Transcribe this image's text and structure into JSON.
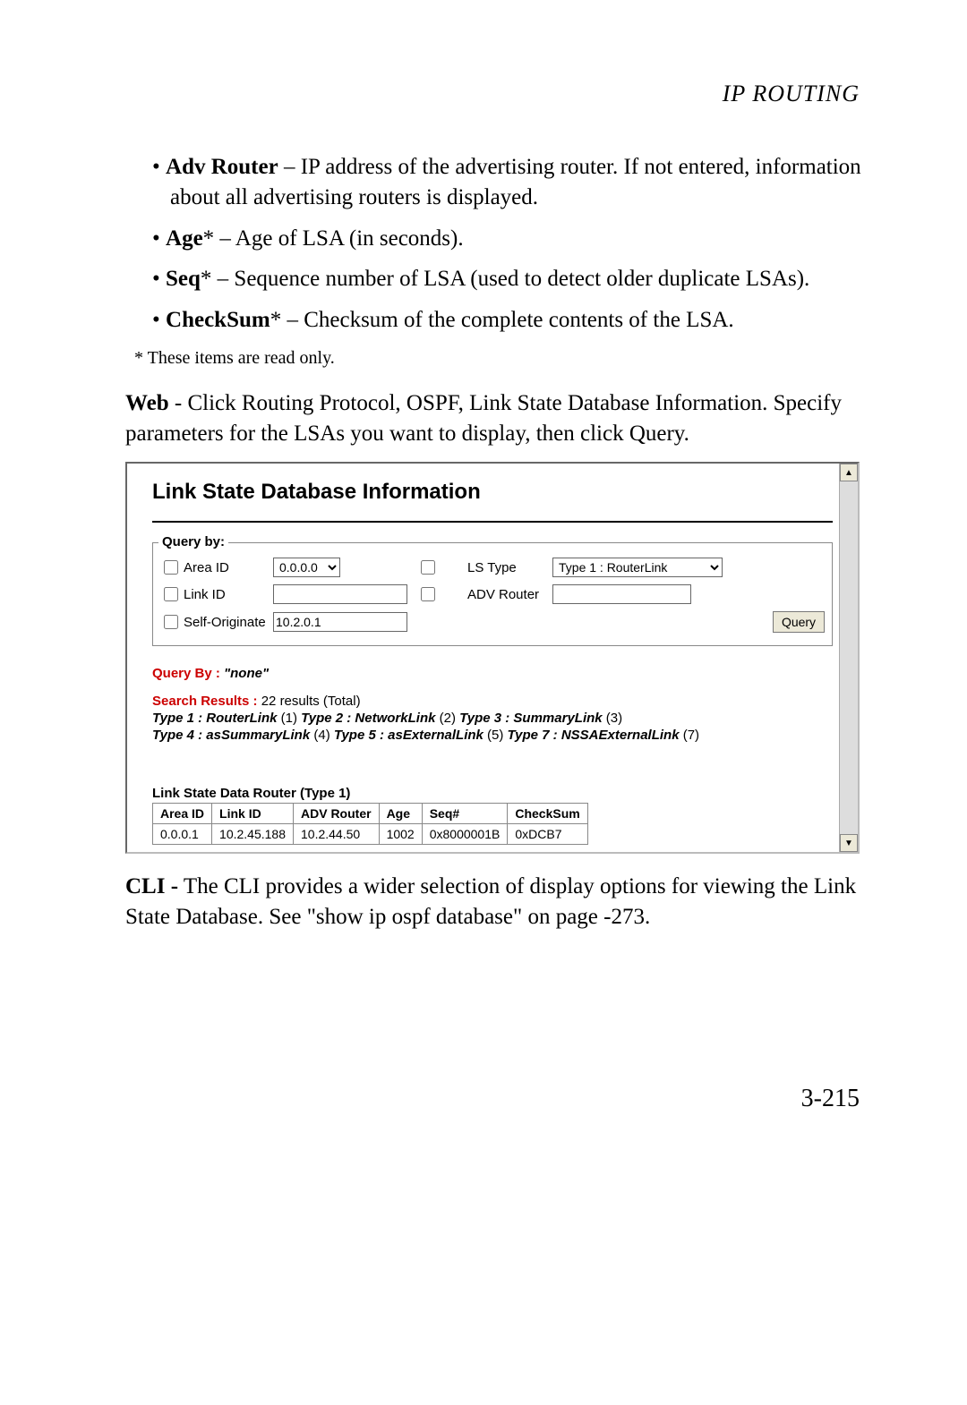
{
  "header": {
    "section": "IP ROUTING"
  },
  "bullets": {
    "adv_router_term": "Adv Router",
    "adv_router_desc": " – IP address of the advertising router. If not entered, information about all advertising routers is displayed.",
    "age_term": "Age",
    "age_desc": "* – Age of LSA (in seconds).",
    "seq_term": "Seq",
    "seq_desc": "* – Sequence number of LSA (used to detect older duplicate LSAs).",
    "checksum_term": "CheckSum",
    "checksum_desc": "* – Checksum of the complete contents of the LSA."
  },
  "footnote": "*   These items are read only.",
  "web_para_bold": "Web",
  "web_para_rest": " - Click Routing Protocol, OSPF, Link State Database Information. Specify parameters for the LSAs you want to display, then click Query.",
  "inset": {
    "title": "Link State Database Information",
    "query_by_label": "Query by:",
    "fields": {
      "area_id_label": "Area ID",
      "area_id_value": "0.0.0.0",
      "ls_type_label": "LS Type",
      "ls_type_value": "Type 1 : RouterLink",
      "link_id_label": "Link ID",
      "link_id_value": "",
      "adv_router_label": "ADV Router",
      "adv_router_value": "",
      "self_orig_label": "Self-Originate",
      "self_orig_value": "10.2.0.1",
      "query_btn": "Query"
    },
    "results": {
      "qb_prefix": "Query By : ",
      "qb_value": "\"none\"",
      "sr_label": "Search Results :",
      "sr_count": " 22 results (Total)",
      "types_line1_a": "Type 1 : RouterLink",
      "types_line1_a_n": " (1)    ",
      "types_line1_b": "Type 2 : NetworkLink",
      "types_line1_b_n": " (2)    ",
      "types_line1_c": "Type 3 : SummaryLink",
      "types_line1_c_n": " (3)",
      "types_line2_a": "Type 4 : asSummaryLink",
      "types_line2_a_n": " (4)    ",
      "types_line2_b": "Type 5 : asExternalLink",
      "types_line2_b_n": " (5)    ",
      "types_line2_c": "Type 7 : NSSAExternalLink",
      "types_line2_c_n": " (7)",
      "table_title": "Link State Data Router (Type 1)",
      "columns": [
        "Area ID",
        "Link ID",
        "ADV Router",
        "Age",
        "Seq#",
        "CheckSum"
      ],
      "row": [
        "0.0.0.1",
        "10.2.45.188",
        "10.2.44.50",
        "1002",
        "0x8000001B",
        "0xDCB7"
      ]
    }
  },
  "cli_para_bold": "CLI -",
  "cli_para_rest": " The CLI provides a wider selection of display options for viewing the Link State Database. See \"show ip ospf database\" on page -273.",
  "page_number": "3-215"
}
